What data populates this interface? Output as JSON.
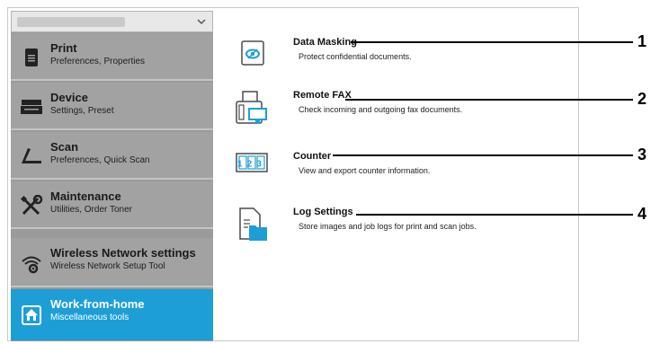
{
  "sidebar": {
    "items": [
      {
        "title": "Print",
        "subtitle": "Preferences, Properties",
        "icon": "print-icon"
      },
      {
        "title": "Device",
        "subtitle": "Settings, Preset",
        "icon": "device-icon"
      },
      {
        "title": "Scan",
        "subtitle": "Preferences, Quick Scan",
        "icon": "scan-icon"
      },
      {
        "title": "Maintenance",
        "subtitle": "Utilities, Order Toner",
        "icon": "tools-icon"
      },
      {
        "title": "Wireless Network settings",
        "subtitle": "Wireless Network Setup Tool",
        "icon": "wireless-gear-icon"
      },
      {
        "title": "Work-from-home",
        "subtitle": "Miscellaneous tools",
        "icon": "home-icon"
      }
    ],
    "active_index": 5
  },
  "tools": [
    {
      "name": "Data Masking",
      "description": "Protect confidential documents.",
      "icon": "eye-mask-icon"
    },
    {
      "name": "Remote FAX",
      "description": "Check incoming and outgoing fax documents.",
      "icon": "fax-monitor-icon"
    },
    {
      "name": "Counter",
      "description": "View and export counter information.",
      "icon": "counter-icon"
    },
    {
      "name": "Log Settings",
      "description": "Store images and job logs for print and scan jobs.",
      "icon": "log-folder-icon"
    }
  ],
  "counter_icon_digits": "123",
  "callouts": [
    "1",
    "2",
    "3",
    "4"
  ],
  "colors": {
    "sidebar_bg": "#a2a2a2",
    "active_bg": "#1e9ed6",
    "icon_blue": "#1e9ed6"
  }
}
